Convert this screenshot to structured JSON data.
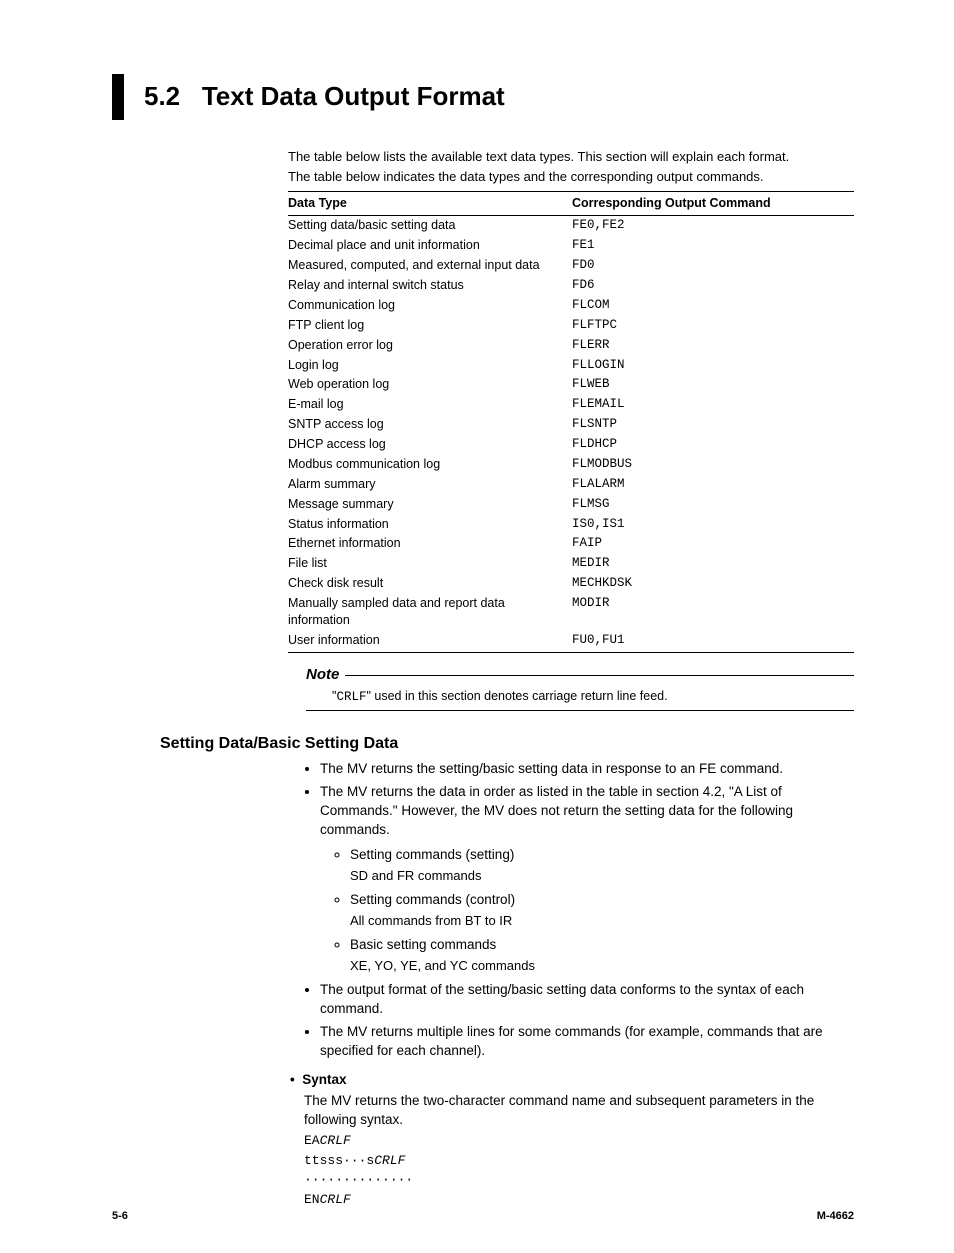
{
  "heading": {
    "number": "5.2",
    "title": "Text Data Output Format"
  },
  "intro": {
    "line1": "The table below lists the available text data types. This section will explain each format.",
    "line2": "The table below indicates the data types and the corresponding output commands."
  },
  "table": {
    "head_left": "Data Type",
    "head_right": "Corresponding Output Command",
    "rows": [
      {
        "type": "Setting data/basic setting data",
        "cmd": "FE0,FE2"
      },
      {
        "type": "Decimal place and unit information",
        "cmd": "FE1"
      },
      {
        "type": "Measured, computed, and external input data",
        "cmd": "FD0"
      },
      {
        "type": "Relay and internal switch status",
        "cmd": "FD6"
      },
      {
        "type": "Communication log",
        "cmd": "FLCOM"
      },
      {
        "type": "FTP client log",
        "cmd": "FLFTPC"
      },
      {
        "type": "Operation error log",
        "cmd": "FLERR"
      },
      {
        "type": "Login log",
        "cmd": "FLLOGIN"
      },
      {
        "type": "Web operation log",
        "cmd": "FLWEB"
      },
      {
        "type": "E-mail log",
        "cmd": "FLEMAIL"
      },
      {
        "type": "SNTP access log",
        "cmd": "FLSNTP"
      },
      {
        "type": "DHCP access log",
        "cmd": "FLDHCP"
      },
      {
        "type": "Modbus communication log",
        "cmd": "FLMODBUS"
      },
      {
        "type": "Alarm summary",
        "cmd": "FLALARM"
      },
      {
        "type": "Message summary",
        "cmd": "FLMSG"
      },
      {
        "type": "Status information",
        "cmd": "IS0,IS1"
      },
      {
        "type": "Ethernet information",
        "cmd": "FAIP"
      },
      {
        "type": "File list",
        "cmd": "MEDIR"
      },
      {
        "type": "Check disk result",
        "cmd": "MECHKDSK"
      },
      {
        "type": "Manually sampled data and report data information",
        "cmd": "MODIR"
      },
      {
        "type": "User information",
        "cmd": "FU0,FU1"
      }
    ]
  },
  "note": {
    "label": "Note",
    "prefix_quote": "\"",
    "code": "CRLF",
    "suffix_quote": "\"",
    "rest": " used in this section denotes carriage return line feed."
  },
  "section2": {
    "title": "Setting Data/Basic Setting Data",
    "b1": "The MV returns the setting/basic setting data in response to an FE command.",
    "b2": "The MV returns the data in order as listed in the table in section 4.2, \"A List of Commands.\" However, the MV does not return the setting data for the following commands.",
    "sub": [
      {
        "head": "Setting commands (setting)",
        "desc": "SD and FR commands"
      },
      {
        "head": "Setting commands (control)",
        "desc": "All commands from BT to IR"
      },
      {
        "head": "Basic setting commands",
        "desc": "XE, YO, YE, and YC commands"
      }
    ],
    "b3": "The output format of the setting/basic setting data conforms to the syntax of each command.",
    "b4": "The MV returns multiple lines for some commands (for example, commands that are specified for each channel).",
    "syntax": {
      "label": "Syntax",
      "intro": "The MV returns the two-character command name and subsequent parameters in the following syntax.",
      "l1a": "EA",
      "l1b": "CRLF",
      "l2a": "ttsss···s",
      "l2b": "CRLF",
      "l3": "··············",
      "l4a": "EN",
      "l4b": "CRLF"
    }
  },
  "footer": {
    "left": "5-6",
    "right": "M-4662"
  }
}
